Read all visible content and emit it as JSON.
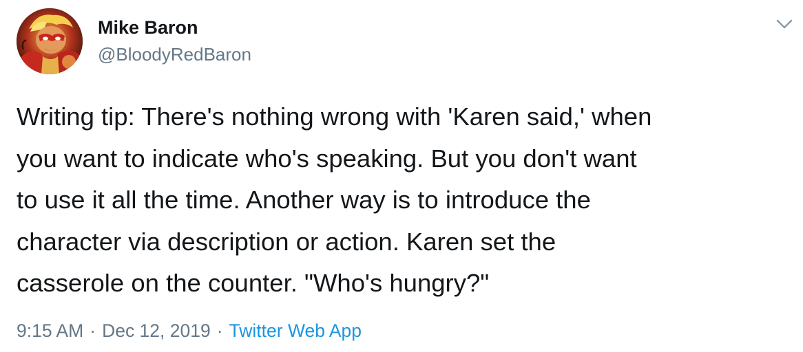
{
  "author": {
    "display_name": "Mike Baron",
    "handle": "@BloodyRedBaron",
    "avatar_icon": "avatar-comic-hero"
  },
  "tweet": {
    "text": "Writing tip: There's nothing wrong with 'Karen said,' when\nyou want to indicate who's speaking. But you don't want\nto use it all the time. Another way is to introduce the\ncharacter via description or action. Karen set the\ncasserole on the counter. \"Who's hungry?\"",
    "time": "9:15 AM",
    "date": "Dec 12, 2019",
    "separator": "·",
    "source": "Twitter Web App"
  },
  "menu": {
    "icon": "chevron-down-icon"
  },
  "colors": {
    "text": "#14171a",
    "secondary": "#657786",
    "link": "#1b95e0"
  }
}
